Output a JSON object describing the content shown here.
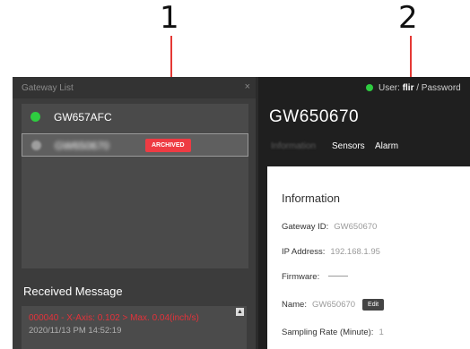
{
  "callouts": [
    {
      "number": "1",
      "color": "#e53935"
    },
    {
      "number": "2",
      "color": "#e53935"
    }
  ],
  "gateway_list": {
    "title": "Gateway List",
    "close_icon": "×",
    "items": [
      {
        "name": "GW657AFC",
        "status_color": "#2ecc40"
      },
      {
        "name": "GW650670",
        "status_color": "#9e9e9e",
        "badge": "ARCHIVED",
        "badge_color": "#ee3b43"
      }
    ]
  },
  "received_message": {
    "title": "Received Message",
    "message": "000040 - X-Axis: 0.102 > Max. 0.04(inch/s)",
    "timestamp": "2020/11/13 PM 14:52:19",
    "scroll_icon": "▲"
  },
  "header": {
    "user_label": "User:",
    "user_name": "flir",
    "password_label": "/ Password",
    "status_color": "#2ecc40"
  },
  "gateway_title": "GW650670",
  "tabs": [
    "Information",
    "Sensors",
    "Alarm"
  ],
  "information": {
    "title": "Information",
    "gateway_id_label": "Gateway ID:",
    "gateway_id": "GW650670",
    "ip_label": "IP Address:",
    "ip": "192.168.1.95",
    "firmware_label": "Firmware:",
    "name_label": "Name:",
    "name": "GW650670",
    "edit_label": "Edit",
    "sampling_label": "Sampling Rate (Minute):",
    "sampling_value": "1"
  }
}
